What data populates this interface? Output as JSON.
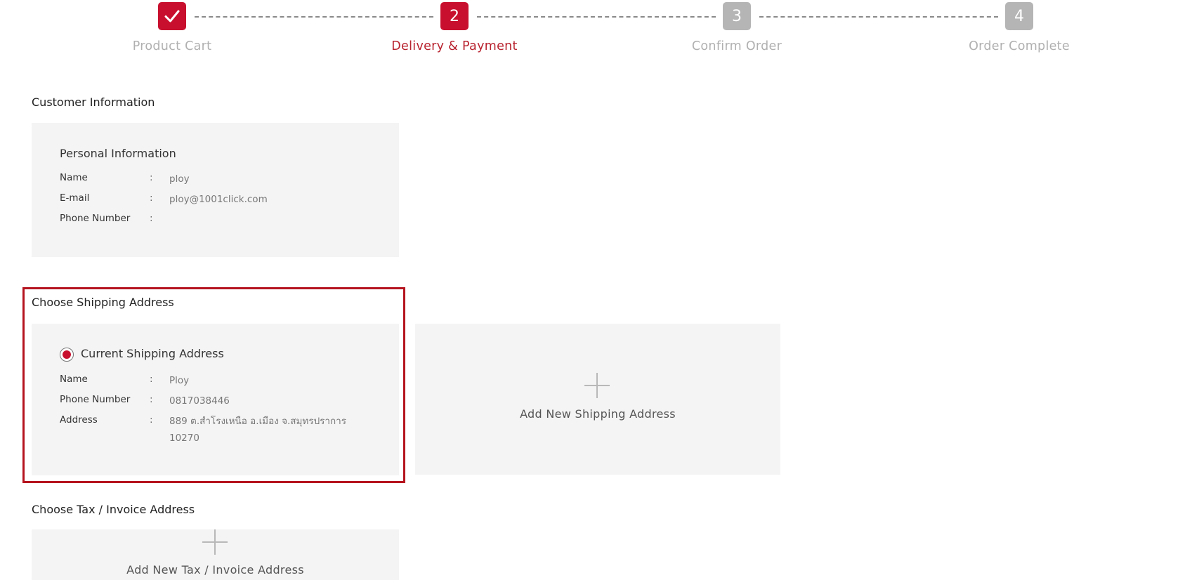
{
  "stepper": {
    "steps": [
      {
        "number": "✓",
        "label": "Product Cart",
        "state": "done"
      },
      {
        "number": "2",
        "label": "Delivery & Payment",
        "state": "active"
      },
      {
        "number": "3",
        "label": "Confirm Order",
        "state": "todo"
      },
      {
        "number": "4",
        "label": "Order Complete",
        "state": "todo"
      }
    ]
  },
  "customer": {
    "section_title": "Customer Information",
    "card_heading": "Personal Information",
    "rows": [
      {
        "label": "Name",
        "sep": ":",
        "value": "ploy"
      },
      {
        "label": "E-mail",
        "sep": ":",
        "value": "ploy@1001click.com"
      },
      {
        "label": "Phone Number",
        "sep": ":",
        "value": ""
      }
    ]
  },
  "shipping": {
    "section_title": "Choose Shipping Address",
    "current": {
      "heading": "Current Shipping Address",
      "selected": true,
      "rows": [
        {
          "label": "Name",
          "sep": ":",
          "value": "Ploy"
        },
        {
          "label": "Phone Number",
          "sep": ":",
          "value": "0817038446"
        },
        {
          "label": "Address",
          "sep": ":",
          "value": "889 ต.สำโรงเหนือ อ.เมือง จ.สมุทรปราการ",
          "value2": "10270"
        }
      ]
    },
    "add_label": "Add New Shipping Address"
  },
  "tax": {
    "section_title": "Choose Tax / Invoice Address",
    "add_label": "Add New Tax / Invoice Address"
  },
  "colors": {
    "accent": "#c8102e",
    "inactive_step": "#b5b5b5",
    "card_bg": "#f4f4f4"
  }
}
